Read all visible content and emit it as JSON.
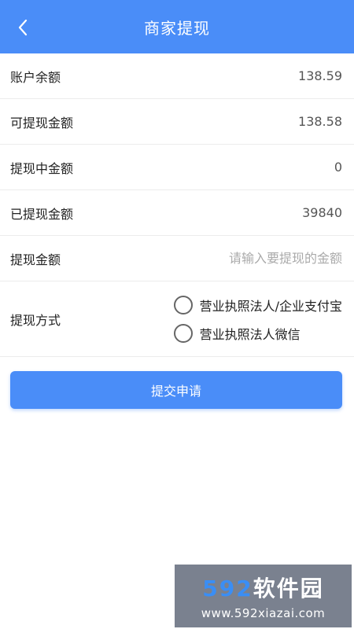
{
  "header": {
    "title": "商家提现"
  },
  "rows": [
    {
      "label": "账户余额",
      "value": "138.59"
    },
    {
      "label": "可提现金额",
      "value": "138.58"
    },
    {
      "label": "提现中金额",
      "value": "0"
    },
    {
      "label": "已提现金额",
      "value": "39840"
    }
  ],
  "amount": {
    "label": "提现金额",
    "placeholder": "请输入要提现的金额"
  },
  "method": {
    "label": "提现方式",
    "options": [
      "营业执照法人/企业支付宝",
      "营业执照法人微信"
    ]
  },
  "submit_label": "提交申请",
  "watermark": {
    "logo_num": "592",
    "logo_text": "软件园",
    "url": "www.592xiazai.com"
  },
  "colors": {
    "accent": "#4a8df8"
  }
}
